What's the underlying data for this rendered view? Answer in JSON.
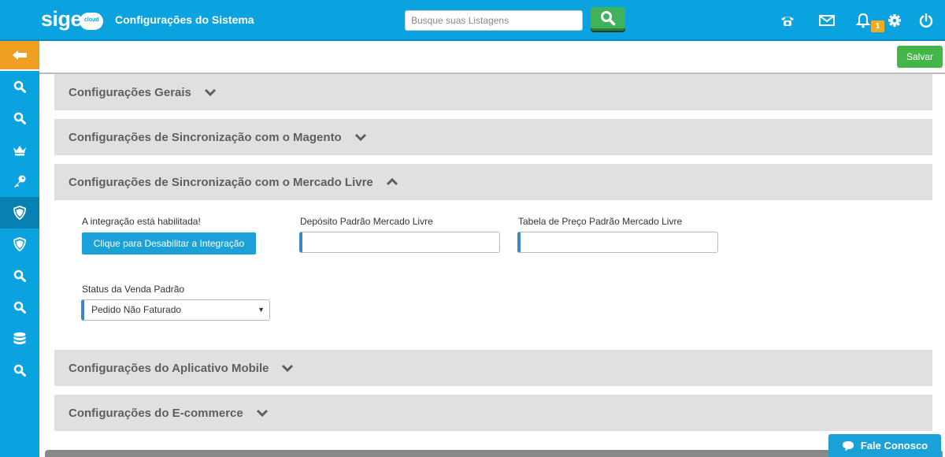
{
  "app": {
    "logo_text": "sige",
    "logo_sub": "cloud",
    "page_title": "Configurações do Sistema"
  },
  "search": {
    "placeholder": "Busque suas Listagens"
  },
  "header_icons": [
    "phone-icon",
    "mail-icon",
    "bell-icon",
    "gear-icon",
    "power-icon"
  ],
  "notifications": {
    "count": "1"
  },
  "toolbar": {
    "save_label": "Salvar"
  },
  "sidebar": {
    "items": [
      "back-arrow-icon",
      "search-icon",
      "search-icon",
      "crown-icon",
      "key-icon",
      "shield-icon",
      "shield-icon",
      "search-icon",
      "search-icon",
      "database-icon",
      "search-icon"
    ]
  },
  "sections": {
    "general": "Configurações Gerais",
    "magento": "Configurações de Sincronização com o Magento",
    "mercado_livre": "Configurações de Sincronização com o Mercado Livre",
    "mobile": "Configurações do Aplicativo Mobile",
    "ecommerce": "Configurações do E-commerce"
  },
  "mercado_livre": {
    "integration_status": "A integração está habilitada!",
    "disable_button": "Clique para Desabilitar a Integração",
    "deposit_label": "Depósito Padrão Mercado Livre",
    "deposit_value": "",
    "price_table_label": "Tabela de Preço Padrão Mercado Livre",
    "price_table_value": "",
    "sale_status_label": "Status da Venda Padrão",
    "sale_status_value": "Pedido Não Faturado"
  },
  "chat": {
    "label": "Fale Conosco"
  },
  "colors": {
    "primary": "#0aa3e0",
    "accent_orange": "#f0a020",
    "success": "#44b649",
    "section_bg": "#e0e0e0"
  }
}
